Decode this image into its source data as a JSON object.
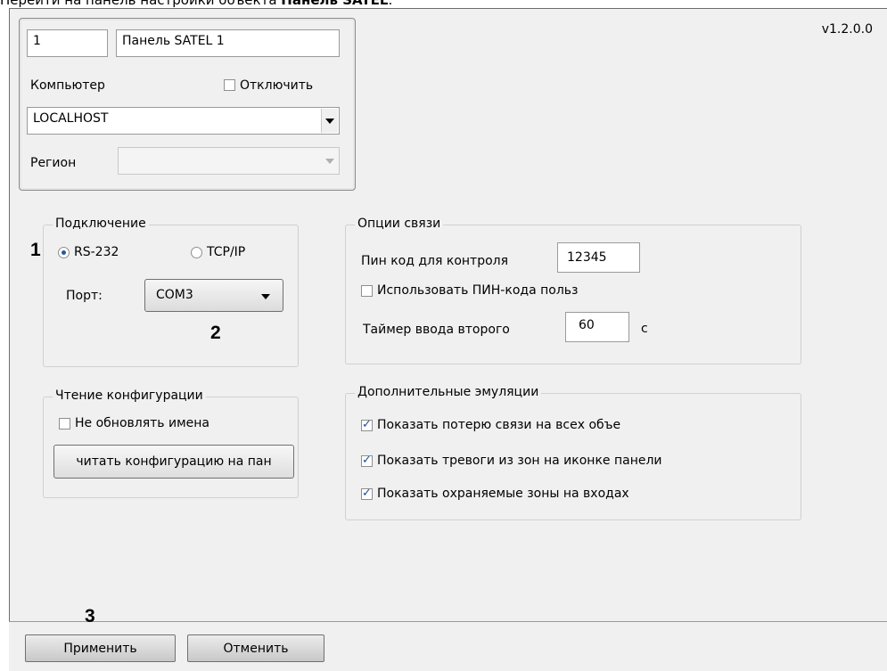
{
  "caption": {
    "text": "Перейти на панель настройки объекта ",
    "bold": "Панель SATEL",
    "end": "."
  },
  "version": "v1.2.0.0",
  "object": {
    "id": "1",
    "name": "Панель SATEL 1",
    "computer_label": "Компьютер",
    "disable_label": "Отключить",
    "disable_checked": false,
    "computer_value": "LOCALHOST",
    "region_label": "Регион",
    "region_value": ""
  },
  "connection": {
    "title": "Подключение",
    "rs232_label": "RS-232",
    "tcpip_label": "TCP/IP",
    "selected": "RS-232",
    "port_label": "Порт:",
    "port_value": "COM3"
  },
  "comm_options": {
    "title": "Опции связи",
    "pin_label": "Пин код для контроля",
    "pin_value": "12345",
    "use_pin_label": "Использовать ПИН-кода польз",
    "use_pin_checked": false,
    "timer_label": "Таймер ввода второго",
    "timer_value": "60",
    "timer_unit": "с"
  },
  "read_config": {
    "title": "Чтение конфигурации",
    "no_update_label": "Не обновлять имена",
    "no_update_checked": false,
    "read_button": "читать конфигурацию на пан"
  },
  "emulations": {
    "title": "Дополнительные эмуляции",
    "items": [
      {
        "label": "Показать потерю связи на всех объе",
        "checked": true
      },
      {
        "label": "Показать тревоги из зон на иконке панели",
        "checked": true
      },
      {
        "label": "Показать охраняемые зоны на входах",
        "checked": true
      }
    ]
  },
  "markers": {
    "m1": "1",
    "m2": "2",
    "m3": "3"
  },
  "footer": {
    "apply": "Применить",
    "cancel": "Отменить"
  }
}
